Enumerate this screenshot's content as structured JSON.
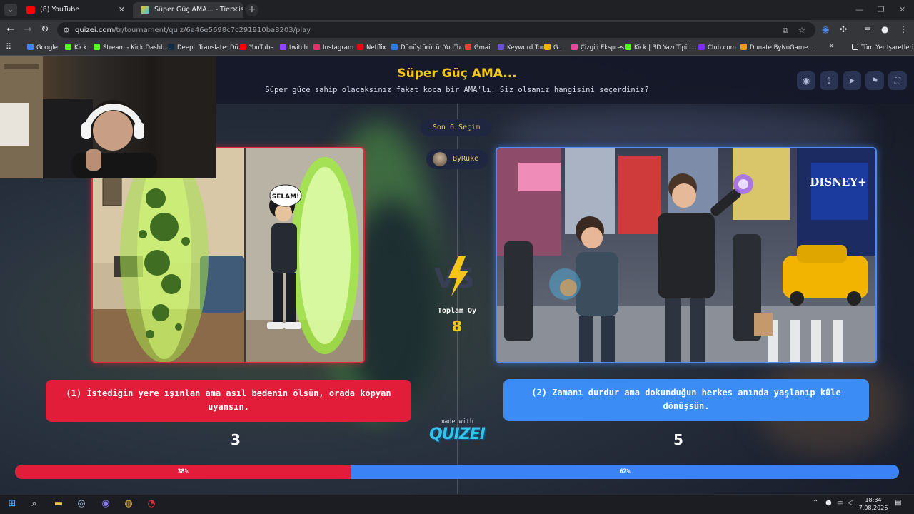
{
  "browser": {
    "tabs": [
      {
        "title": "(8) YouTube",
        "active": false
      },
      {
        "title": "Süper Güç AMA... - Tier List, Kı",
        "active": true
      }
    ],
    "url_host": "quizei.com",
    "url_path": "/tr/tournament/quiz/6a46e5698c7c291910ba8203/play",
    "bookmarks": [
      "Google",
      "Kick",
      "Stream - Kick Dashb...",
      "DeepL Translate: Dü...",
      "YouTube",
      "twitch",
      "Instagram",
      "Netflix",
      "Dönüştürücü: YouTu...",
      "Gmail",
      "Keyword Tool",
      "G...",
      "Çizgili Ekspres",
      "Kick | 3D Yazı Tipi |...",
      "Club.com",
      "Donate ByNoGame..."
    ],
    "all_bookmarks": "Tüm Yer İşaretleri"
  },
  "quiz": {
    "title": "Süper Güç AMA...",
    "subtitle": "Süper güce sahip olacaksınız fakat koca bir AMA'lı. Siz olsanız hangisini seçerdiniz?",
    "round": "Son 6 Seçim",
    "author": "ByRuke",
    "total_label": "Toplam Oy",
    "total_votes": "8",
    "left": {
      "text": "(1) İstediğin yere ışınlan ama asıl bedenin ölsün, orada kopyan uyansın.",
      "votes": "3",
      "percent_label": "38%",
      "percent": 38
    },
    "right": {
      "text": "(2) Zamanı durdur ama dokunduğun herkes anında yaşlanıp küle dönüşsün.",
      "votes": "5",
      "percent_label": "62%",
      "percent": 62
    },
    "made_with": "made with",
    "logo": "QUIZEI",
    "speech": "SELAM!",
    "brand_sign": "DISNEY+"
  },
  "colors": {
    "left": "#e11d39",
    "right": "#3b82f6",
    "title": "#f5c518"
  },
  "taskbar": {
    "time": "18:34",
    "date": "7.08.2026"
  }
}
